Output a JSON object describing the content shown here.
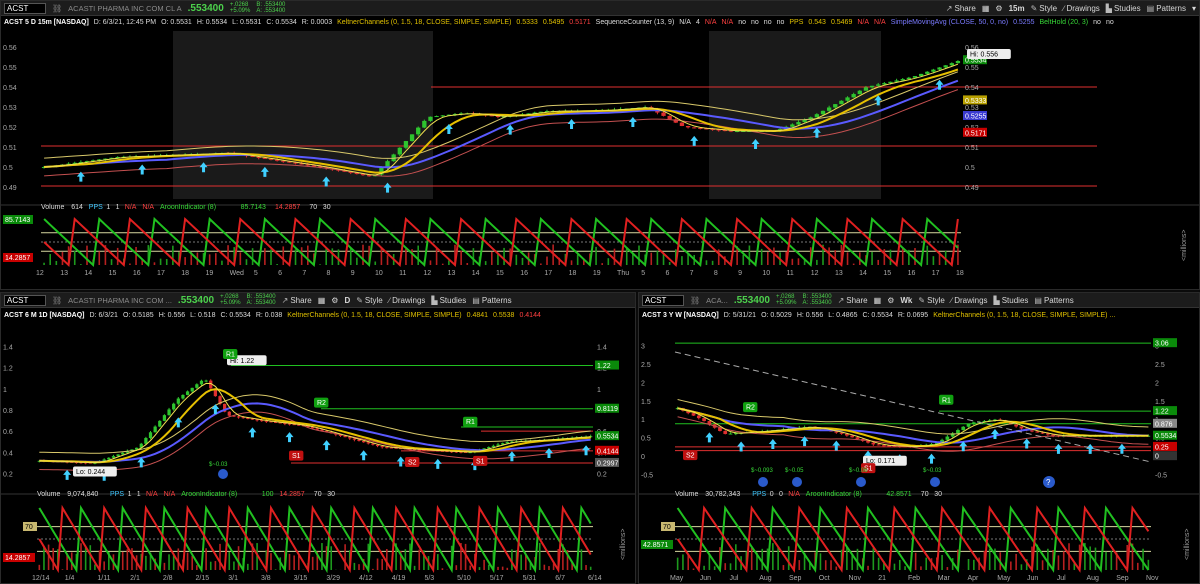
{
  "top": {
    "symbol": "ACST",
    "desc": "ACASTI PHARMA INC COM CL A",
    "price": ".553400",
    "chg1": "+.0268",
    "chg2": "+5.09%",
    "bid": "B: .553400",
    "ask": "A: .553400",
    "share": "Share",
    "interval": "15m",
    "style": "Style",
    "drawings": "Drawings",
    "studies": "Studies",
    "patterns": "Patterns",
    "title": "ACST 5 D 15m [NASDAQ]",
    "ohlc": "D: 6/3/21, 12:45 PM",
    "o": "O: 0.5531",
    "h": "H: 0.5534",
    "l": "L: 0.5531",
    "c": "C: 0.5534",
    "r": "R: 0.0003",
    "keltner": "KeltnerChannels (0, 1.5, 18, CLOSE, SIMPLE, SIMPLE)",
    "k1": "0.5333",
    "k2": "0.5495",
    "k3": "0.5171",
    "seq": "SequenceCounter (13, 9)",
    "seq_vals": [
      "N/A",
      "4",
      "N/A",
      "N/A",
      "no",
      "no",
      "no",
      "no"
    ],
    "pps": "PPS",
    "pps_v1": "0.543",
    "pps_v2": "0.5469",
    "pps_na": [
      "N/A",
      "N/A"
    ],
    "sma": "SimpleMovingAvg (CLOSE, 50, 0, no)",
    "sma_v": "0.5255",
    "belt": "BeltHold (20, 3)",
    "belt_v": [
      "no",
      "no"
    ],
    "hi_label": "Hi: 0.556",
    "y_ticks": [
      "0.56",
      "0.55",
      "0.54",
      "0.53",
      "0.52",
      "0.51",
      "0.5",
      "0.49"
    ],
    "price_badges": [
      "0.5534",
      "0.55",
      "0.5333",
      "0.5255",
      "0.5171"
    ],
    "lower": {
      "volume": "Volume",
      "vol_v": "614",
      "pps": "PPS",
      "pps_v": [
        "1",
        "1",
        "N/A",
        "N/A"
      ],
      "aroon": "AroonIndicator (8)",
      "aroon_up": "85.7143",
      "aroon_dn": "14.2857",
      "lv": [
        "70",
        "30"
      ],
      "badge_up": "85.7143",
      "badge_dn": "14.2857",
      "ticks": [
        "100",
        "75",
        "50",
        "25",
        "0"
      ],
      "r_ticks": [
        "2",
        "1",
        "0"
      ],
      "unit": "<millions>"
    },
    "x_ticks": [
      "12",
      "13",
      "14",
      "15",
      "16",
      "17",
      "18",
      "19",
      "Wed",
      "5",
      "6",
      "7",
      "8",
      "9",
      "10",
      "11",
      "12",
      "13",
      "14",
      "15",
      "16",
      "17",
      "18",
      "19",
      "Thu",
      "5",
      "6",
      "7",
      "8",
      "9",
      "10",
      "11",
      "12",
      "13",
      "14",
      "15",
      "16",
      "17",
      "18"
    ]
  },
  "bl": {
    "symbol": "ACST",
    "desc": "ACASTI PHARMA INC COM ...",
    "price": ".553400",
    "chg1": "+.0268",
    "chg2": "+5.09%",
    "bid": "B: .553400",
    "ask": "A: .553400",
    "share": "Share",
    "interval": "D",
    "style": "Style",
    "drawings": "Drawings",
    "studies": "Studies",
    "patterns": "Patterns",
    "title": "ACST 6 M 1D [NASDAQ]",
    "date": "D: 6/3/21",
    "o": "O: 0.5185",
    "h": "H: 0.556",
    "l": "L: 0.518",
    "c": "C: 0.5534",
    "r": "R: 0.038",
    "keltner": "KeltnerChannels (0, 1.5, 18, CLOSE, SIMPLE, SIMPLE)",
    "k1": "0.4841",
    "k2": "0.5538",
    "k3": "0.4144",
    "hi_label": "Hi: 1.22",
    "lo_label": "Lo: 0.244",
    "y_ticks": [
      "1.4",
      "1.2",
      "1",
      "0.8",
      "0.6",
      "0.4",
      "0.2"
    ],
    "r_ticks": [
      "1.4",
      "1.2",
      "1",
      "0.8",
      "0.6",
      "0.4",
      "0.2"
    ],
    "badges": [
      "1.22",
      "0.8119",
      "0.5534",
      "0.4144",
      "0.2997"
    ],
    "r_labels": [
      "R1",
      "R2",
      "R1",
      "S1",
      "S2",
      "S1",
      "S2",
      "S3"
    ],
    "div": [
      "$~0.03"
    ],
    "lower": {
      "volume": "Volume",
      "vol_v": "9,074,840",
      "pps": "PPS",
      "pps_v": [
        "1",
        "1",
        "N/A",
        "N/A"
      ],
      "aroon": "AroonIndicator (8)",
      "aroon_up": "100",
      "aroon_dn": "14.2857",
      "lv": [
        "70",
        "30"
      ],
      "ticks": [
        "100",
        "70",
        "50",
        "30",
        "0"
      ],
      "r_ticks": [
        "400",
        "200",
        "0"
      ],
      "badge_l1": "70",
      "badge_l2": "14.2857",
      "unit": "<millions>"
    },
    "x_ticks": [
      "12/14",
      "1/4",
      "1/11",
      "2/1",
      "2/8",
      "2/15",
      "3/1",
      "3/8",
      "3/15",
      "3/29",
      "4/12",
      "4/19",
      "5/3",
      "5/10",
      "5/17",
      "5/31",
      "6/7",
      "6/14"
    ]
  },
  "br": {
    "symbol": "ACST",
    "desc": "ACA...",
    "price": ".553400",
    "chg1": "+.0268",
    "chg2": "+5.09%",
    "bid": "B: .553400",
    "ask": "A: .553400",
    "share": "Share",
    "interval": "Wk",
    "style": "Style",
    "drawings": "Drawings",
    "studies": "Studies",
    "patterns": "Patterns",
    "title": "ACST 3 Y W [NASDAQ]",
    "date": "D: 5/31/21",
    "o": "O: 0.5029",
    "h": "H: 0.556",
    "l": "L: 0.4865",
    "c": "C: 0.5534",
    "r": "R: 0.0695",
    "keltner": "KeltnerChannels (0, 1.5, 18, CLOSE, SIMPLE, SIMPLE) ...",
    "lo_label": "Lo: 0.171",
    "y_ticks": [
      "3",
      "2.5",
      "2",
      "1.5",
      "1",
      "0.5",
      "0",
      "-0.5"
    ],
    "r_ticks": [
      "3",
      "2.5",
      "2",
      "1.5",
      "1",
      "0.5",
      "0",
      "-0.5"
    ],
    "badges": [
      "3.06",
      "1.22",
      "0.876",
      "0.5534",
      "0.25",
      "0"
    ],
    "div": [
      "$~0.093",
      "$~0.05",
      "$~0.03",
      "$~0.03",
      "$~0.06"
    ],
    "lower": {
      "volume": "Volume",
      "vol_v": "30,782,343",
      "pps": "PPS",
      "pps_v": [
        "0",
        "0",
        "N/A"
      ],
      "aroon": "AroonIndicator (8)",
      "aroon_up": "42.8571",
      "lv": [
        "70",
        "30"
      ],
      "ticks": [
        "100",
        "70",
        "30",
        "0"
      ],
      "r_ticks": [
        "500",
        "0"
      ],
      "badge_l1": "70",
      "badge_l2": "42.8571",
      "unit": "<millions>"
    },
    "x_ticks": [
      "May",
      "Jun",
      "Jul",
      "Aug",
      "Sep",
      "Oct",
      "Nov",
      "21",
      "Feb",
      "Mar",
      "Apr",
      "May",
      "Jun",
      "Jul",
      "Aug",
      "Sep",
      "Nov"
    ]
  },
  "colors": {
    "green": "#37d737",
    "red": "#ff3030",
    "yellow": "#e6c000",
    "blue": "#5a5aff",
    "cyan": "#40d0ff",
    "badge_green": "#0a8a0a",
    "badge_red": "#c80000"
  }
}
